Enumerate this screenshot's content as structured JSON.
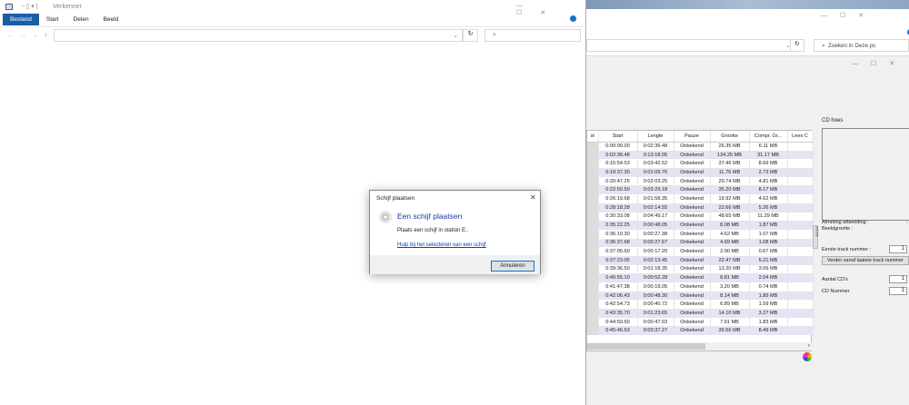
{
  "explorer": {
    "title": "Verkenner",
    "tabs": [
      "Bestand",
      "Start",
      "Delen",
      "Beeld"
    ]
  },
  "explorer2": {
    "search_placeholder": "Zoeken in Deze pc"
  },
  "table": {
    "columns": [
      "st",
      "Start",
      "Lengte",
      "Pauze",
      "Grootte",
      "Compr. Gr...",
      "Lees C"
    ],
    "rows": [
      [
        "0:00:00.00",
        "0:02:36.48",
        "Onbekend",
        "26.35 MB",
        "6.11 MB"
      ],
      [
        "0:02:36.48",
        "0:13:18.05",
        "Onbekend",
        "134.25 MB",
        "31.17 MB"
      ],
      [
        "0:15:54.53",
        "0:03:42.52",
        "Onbekend",
        "37.46 MB",
        "8.69 MB"
      ],
      [
        "0:19:37.30",
        "0:01:09.70",
        "Onbekend",
        "11.76 MB",
        "2.73 MB"
      ],
      [
        "0:20:47.25",
        "0:02:03.25",
        "Onbekend",
        "20.74 MB",
        "4.81 MB"
      ],
      [
        "0:22:50.50",
        "0:03:29.18",
        "Onbekend",
        "35.20 MB",
        "8.17 MB"
      ],
      [
        "0:26:19.68",
        "0:01:58.35",
        "Onbekend",
        "19.92 MB",
        "4.62 MB"
      ],
      [
        "0:28:18.28",
        "0:02:14.55",
        "Onbekend",
        "22.66 MB",
        "5.26 MB"
      ],
      [
        "0:30:33.08",
        "0:04:49.17",
        "Onbekend",
        "48.65 MB",
        "11.29 MB"
      ],
      [
        "0:35:22.25",
        "0:00:48.05",
        "Onbekend",
        "8.08 MB",
        "1.87 MB"
      ],
      [
        "0:36:10.30",
        "0:00:27.38",
        "Onbekend",
        "4.62 MB",
        "1.07 MB"
      ],
      [
        "0:36:37.68",
        "0:00:27.67",
        "Onbekend",
        "4.69 MB",
        "1.08 MB"
      ],
      [
        "0:37:05.60",
        "0:00:17.20",
        "Onbekend",
        "2.90 MB",
        "0.67 MB"
      ],
      [
        "0:37:23.05",
        "0:02:13.45",
        "Onbekend",
        "22.47 MB",
        "5.21 MB"
      ],
      [
        "0:39:36.50",
        "0:01:18.35",
        "Onbekend",
        "13.20 MB",
        "3.06 MB"
      ],
      [
        "0:40:55.10",
        "0:00:52.28",
        "Onbekend",
        "8.81 MB",
        "2.04 MB"
      ],
      [
        "0:41:47.38",
        "0:00:19.05",
        "Onbekend",
        "3.20 MB",
        "0.74 MB"
      ],
      [
        "0:42:06.43",
        "0:00:48.30",
        "Onbekend",
        "8.14 MB",
        "1.89 MB"
      ],
      [
        "0:42:54.73",
        "0:00:40.72",
        "Onbekend",
        "6.89 MB",
        "1.59 MB"
      ],
      [
        "0:43:35.70",
        "0:01:23.65",
        "Onbekend",
        "14.10 MB",
        "3.27 MB"
      ],
      [
        "0:44:59.60",
        "0:00:47.03",
        "Onbekend",
        "7.91 MB",
        "1.83 MB"
      ],
      [
        "0:45:46.63",
        "0:03:37.27",
        "Onbekend",
        "36.56 MB",
        "8.49 MB"
      ]
    ]
  },
  "panel": {
    "cd_cover": "CD hoes",
    "afmeting": "Afmeting afbeelding :",
    "beeldgrootte": "Beeldgrootte :",
    "dash": "-",
    "expand": ">>>>",
    "first_track_label": "Eerste track nummer :",
    "first_track_value": "1",
    "continue_button": "Verder vanaf laatste track nummer",
    "cd_count_label": "Aantal CD's",
    "cd_count_value": "1",
    "cd_number_label": "CD Nummer",
    "cd_number_value": "1"
  },
  "dialog": {
    "title": "Schijf plaatsen",
    "heading": "Een schijf plaatsen",
    "message": "Plaats een schijf in station E:.",
    "help_link": "Hulp bij het selecteren van een schijf",
    "cancel": "Annuleren"
  }
}
